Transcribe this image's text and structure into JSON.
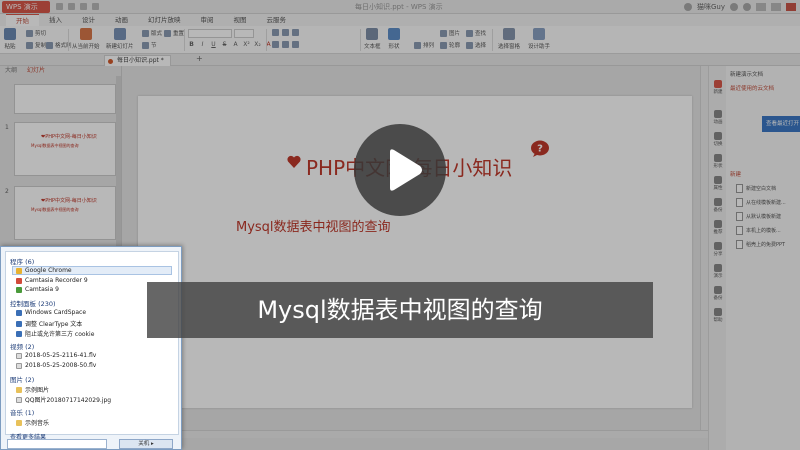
{
  "app": {
    "button_label": "WPS 演示",
    "window_title": "每日小知识.ppt - WPS 演示",
    "user_name": "猫咪Guy"
  },
  "menu": {
    "tabs": [
      "开始",
      "插入",
      "设计",
      "动画",
      "幻灯片放映",
      "审阅",
      "视图",
      "云服务"
    ],
    "active_tab": "开始"
  },
  "ribbon": {
    "paste": "粘贴",
    "cut": "剪切",
    "copy": "复制",
    "format_painter": "格式刷",
    "from_current": "从当前开始",
    "new_slide": "新建幻灯片",
    "layout": "版式",
    "reset": "重置",
    "section": "节",
    "font_name": "",
    "font_size": "",
    "text_box": "文本框",
    "shapes": "形状",
    "arrange": "排列",
    "outline": "轮廓",
    "picture": "图片",
    "find": "查找",
    "replace": "替换",
    "select": "选择",
    "select_pane": "选择窗格",
    "design_assistant": "设计助手",
    "format_buttons": [
      "B",
      "I",
      "U",
      "S",
      "A",
      "X²",
      "X₂",
      "A"
    ]
  },
  "doc_tab": {
    "label": "每日小知识.ppt *",
    "add": "+"
  },
  "left_panel": {
    "tabs": [
      "大纲",
      "幻灯片"
    ],
    "active_tab": "幻灯片",
    "slides": [
      {
        "num": "",
        "title": "",
        "sub": ""
      },
      {
        "num": "1",
        "title": "❤PHP中文网-每日小知识",
        "sub": "Mysql数据表中视图的查询"
      },
      {
        "num": "2",
        "title": "❤PHP中文网-每日小知识",
        "sub": "Mysql数据表中视图的查询"
      }
    ]
  },
  "slide": {
    "title": "PHP中文网-每日小知识",
    "subtitle": "Mysql数据表中视图的查询"
  },
  "right_strip": {
    "items": [
      "新建",
      "动画",
      "切换",
      "形状",
      "属性",
      "备份",
      "推荐",
      "分享",
      "演示",
      "备份",
      "帮助"
    ]
  },
  "task_pane": {
    "header": "新建演示文档",
    "recent_label": "最近使用的云文档",
    "cloud_button": "查看最近打开",
    "new_label": "新建",
    "items": [
      "新建空白文档",
      "从在线模板新建...",
      "从默认模板新建",
      "本机上的模板...",
      "稻壳上的免费PPT"
    ]
  },
  "start_menu": {
    "sections": [
      {
        "title": "程序 (6)",
        "items": [
          "Google Chrome",
          "Camtasia Recorder 9",
          "Camtasia 9"
        ]
      },
      {
        "title": "控制面板 (230)",
        "items": [
          "Windows CardSpace",
          "调整 ClearType 文本",
          "阻止或允许第三方 cookie"
        ]
      },
      {
        "title": "视频 (2)",
        "items": [
          "2018-05-25-2116-41.flv",
          "2018-05-25-2008-50.flv"
        ]
      },
      {
        "title": "图片 (2)",
        "items": [
          "示例图片",
          "QQ图片20180717142029.jpg"
        ]
      },
      {
        "title": "音乐 (1)",
        "items": [
          "示例音乐"
        ]
      }
    ],
    "more_results": "查看更多结果",
    "search_value": "",
    "shutdown_label": "关机 ▸"
  },
  "video": {
    "caption": "Mysql数据表中视图的查询"
  },
  "colors": {
    "accent": "#c2503e",
    "slide_red": "#c0392b",
    "selection_blue": "#3c78c5"
  }
}
